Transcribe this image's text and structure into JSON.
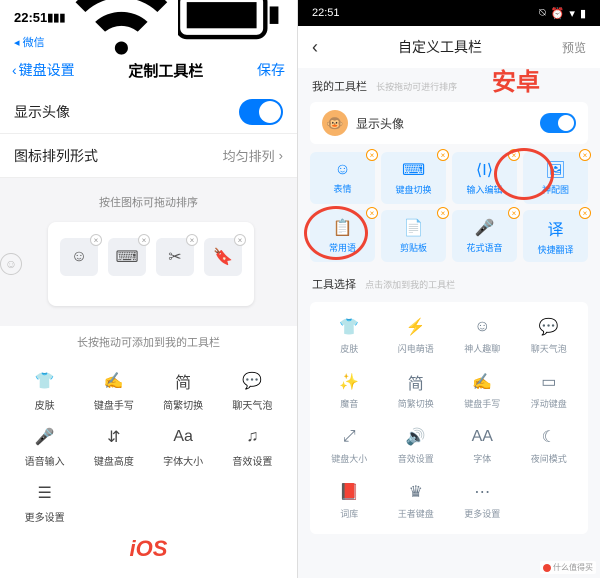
{
  "annotations": {
    "ios": "iOS",
    "android": "安卓"
  },
  "watermark": "什么值得买",
  "ios": {
    "status": {
      "time": "22:51",
      "back_app": "◂ 微信"
    },
    "nav": {
      "back": "键盘设置",
      "title": "定制工具栏",
      "save": "保存"
    },
    "row_avatar": "显示头像",
    "row_layout_label": "图标排列形式",
    "row_layout_value": "均匀排列",
    "drag_hint": "按住图标可拖动排序",
    "toolbar_items": [
      {
        "icon": "emoji"
      },
      {
        "icon": "keyboard"
      },
      {
        "icon": "scissors"
      },
      {
        "icon": "bookmark"
      }
    ],
    "add_hint": "长按拖动可添加到我的工具栏",
    "grid": [
      {
        "label": "皮肤",
        "icon": "shirt"
      },
      {
        "label": "键盘手写",
        "icon": "handwrite"
      },
      {
        "label": "简繁切换",
        "icon": "简"
      },
      {
        "label": "聊天气泡",
        "icon": "bubble"
      },
      {
        "label": "语音输入",
        "icon": "mic"
      },
      {
        "label": "键盘高度",
        "icon": "height"
      },
      {
        "label": "字体大小",
        "icon": "Aa"
      },
      {
        "label": "音效设置",
        "icon": "music"
      },
      {
        "label": "更多设置",
        "icon": "more"
      }
    ]
  },
  "android": {
    "status": {
      "time": "22:51"
    },
    "nav": {
      "title": "自定义工具栏",
      "preview": "预览"
    },
    "section_my": "我的工具栏",
    "section_my_sub": "长按拖动可进行排序",
    "avatar_label": "显示头像",
    "tools": [
      {
        "label": "表情",
        "icon": "emoji"
      },
      {
        "label": "键盘切换",
        "icon": "keyboard"
      },
      {
        "label": "输入编辑",
        "icon": "cursor"
      },
      {
        "label": "神配图",
        "icon": "image"
      },
      {
        "label": "常用语",
        "icon": "note"
      },
      {
        "label": "剪贴板",
        "icon": "clipboard"
      },
      {
        "label": "花式语音",
        "icon": "mic"
      },
      {
        "label": "快捷翻译",
        "icon": "译"
      }
    ],
    "section_opt": "工具选择",
    "section_opt_sub": "点击添加到我的工具栏",
    "options": [
      {
        "label": "皮肤",
        "icon": "shirt"
      },
      {
        "label": "闪电萌语",
        "icon": "flash"
      },
      {
        "label": "神人趣聊",
        "icon": "chat"
      },
      {
        "label": "聊天气泡",
        "icon": "bubble"
      },
      {
        "label": "魔音",
        "icon": "magic"
      },
      {
        "label": "简繁切换",
        "icon": "简"
      },
      {
        "label": "键盘手写",
        "icon": "handwrite"
      },
      {
        "label": "浮动键盘",
        "icon": "float"
      },
      {
        "label": "键盘大小",
        "icon": "resize"
      },
      {
        "label": "音效设置",
        "icon": "sound"
      },
      {
        "label": "字体",
        "icon": "AA"
      },
      {
        "label": "夜间模式",
        "icon": "moon"
      },
      {
        "label": "词库",
        "icon": "dict"
      },
      {
        "label": "王者键盘",
        "icon": "king"
      },
      {
        "label": "更多设置",
        "icon": "more"
      }
    ]
  }
}
